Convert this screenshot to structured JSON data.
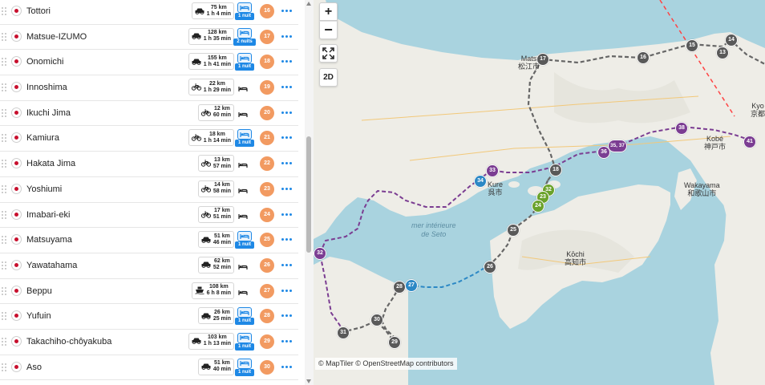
{
  "colors": {
    "accent_blue": "#1e88e5",
    "stop_orange": "#f29a61",
    "car_route": "#555555",
    "ferry_route": "#2c88c5",
    "bike_route": "#7b3d92",
    "flight_line": "#ff4444"
  },
  "stops": [
    {
      "name": "Tottori",
      "mode": "car",
      "distance": "75 km",
      "duration": "1 h 4 min",
      "nights": "1 nuit",
      "number": "16"
    },
    {
      "name": "Matsue-IZUMO",
      "mode": "car",
      "distance": "128 km",
      "duration": "1 h 35 min",
      "nights": "2 nuits",
      "number": "17"
    },
    {
      "name": "Onomichi",
      "mode": "car",
      "distance": "155 km",
      "duration": "1 h 41 min",
      "nights": "1 nuit",
      "number": "18"
    },
    {
      "name": "Innoshima",
      "mode": "bike",
      "distance": "22 km",
      "duration": "1 h 29 min",
      "nights": "",
      "number": "19"
    },
    {
      "name": "Ikuchi Jima",
      "mode": "bike",
      "distance": "12 km",
      "duration": "60 min",
      "nights": "",
      "number": "20"
    },
    {
      "name": "Kamiura",
      "mode": "bike",
      "distance": "18 km",
      "duration": "1 h 14 min",
      "nights": "1 nuit",
      "number": "21"
    },
    {
      "name": "Hakata Jima",
      "mode": "bike",
      "distance": "13 km",
      "duration": "57 min",
      "nights": "",
      "number": "22"
    },
    {
      "name": "Yoshiumi",
      "mode": "bike",
      "distance": "14 km",
      "duration": "58 min",
      "nights": "",
      "number": "23"
    },
    {
      "name": "Imabari-eki",
      "mode": "bike",
      "distance": "17 km",
      "duration": "51 min",
      "nights": "",
      "number": "24"
    },
    {
      "name": "Matsuyama",
      "mode": "car",
      "distance": "51 km",
      "duration": "46 min",
      "nights": "1 nuit",
      "number": "25"
    },
    {
      "name": "Yawatahama",
      "mode": "car",
      "distance": "62 km",
      "duration": "52 min",
      "nights": "",
      "number": "26"
    },
    {
      "name": "Beppu",
      "mode": "ferry",
      "distance": "108 km",
      "duration": "6 h 8 min",
      "nights": "",
      "number": "27"
    },
    {
      "name": "Yufuin",
      "mode": "car",
      "distance": "26 km",
      "duration": "25 min",
      "nights": "1 nuit",
      "number": "28"
    },
    {
      "name": "Takachiho-chôyakuba",
      "mode": "car",
      "distance": "103 km",
      "duration": "1 h 13 min",
      "nights": "1 nuit",
      "number": "29"
    },
    {
      "name": "Aso",
      "mode": "car",
      "distance": "51 km",
      "duration": "40 min",
      "nights": "1 nuit",
      "number": "30"
    }
  ],
  "map": {
    "controls": {
      "zoom_in": "+",
      "zoom_out": "−",
      "mode_2d": "2D"
    },
    "labels": [
      {
        "id": "matsue",
        "line1": "Mats",
        "line2": "松江市"
      },
      {
        "id": "kure",
        "line1": "Kure",
        "line2": "呉市"
      },
      {
        "id": "kobe",
        "line1": "Kobé",
        "line2": "神戸市"
      },
      {
        "id": "wakayama",
        "line1": "Wakayama",
        "line2": "和歌山市"
      },
      {
        "id": "kochi",
        "line1": "Kōchi",
        "line2": "高知市"
      },
      {
        "id": "kyoto",
        "line1": "Kyo",
        "line2": "京都"
      }
    ],
    "sea_label": {
      "line1": "mer intérieure",
      "line2": "de Seto"
    },
    "markers": [
      {
        "num": "14",
        "style": "g"
      },
      {
        "num": "13",
        "style": "g"
      },
      {
        "num": "15",
        "style": "g"
      },
      {
        "num": "16",
        "style": "g"
      },
      {
        "num": "17",
        "style": "g"
      },
      {
        "num": "18",
        "style": "g"
      },
      {
        "num": "41",
        "style": "p"
      },
      {
        "num": "38",
        "style": "p"
      },
      {
        "num": "35, 37",
        "style": "p"
      },
      {
        "num": "36",
        "style": "p"
      },
      {
        "num": "33",
        "style": "p"
      },
      {
        "num": "34",
        "style": "b"
      },
      {
        "num": "32",
        "style": "gr"
      },
      {
        "num": "23",
        "style": "gr"
      },
      {
        "num": "24",
        "style": "gr"
      },
      {
        "num": "25",
        "style": "g"
      },
      {
        "num": "26",
        "style": "g"
      },
      {
        "num": "27",
        "style": "b"
      },
      {
        "num": "28",
        "style": "g"
      },
      {
        "num": "30",
        "style": "g"
      },
      {
        "num": "31",
        "style": "g"
      },
      {
        "num": "29",
        "style": "g"
      },
      {
        "num": "32",
        "style": "p"
      }
    ],
    "attribution": "© MapTiler © OpenStreetMap contributors"
  }
}
